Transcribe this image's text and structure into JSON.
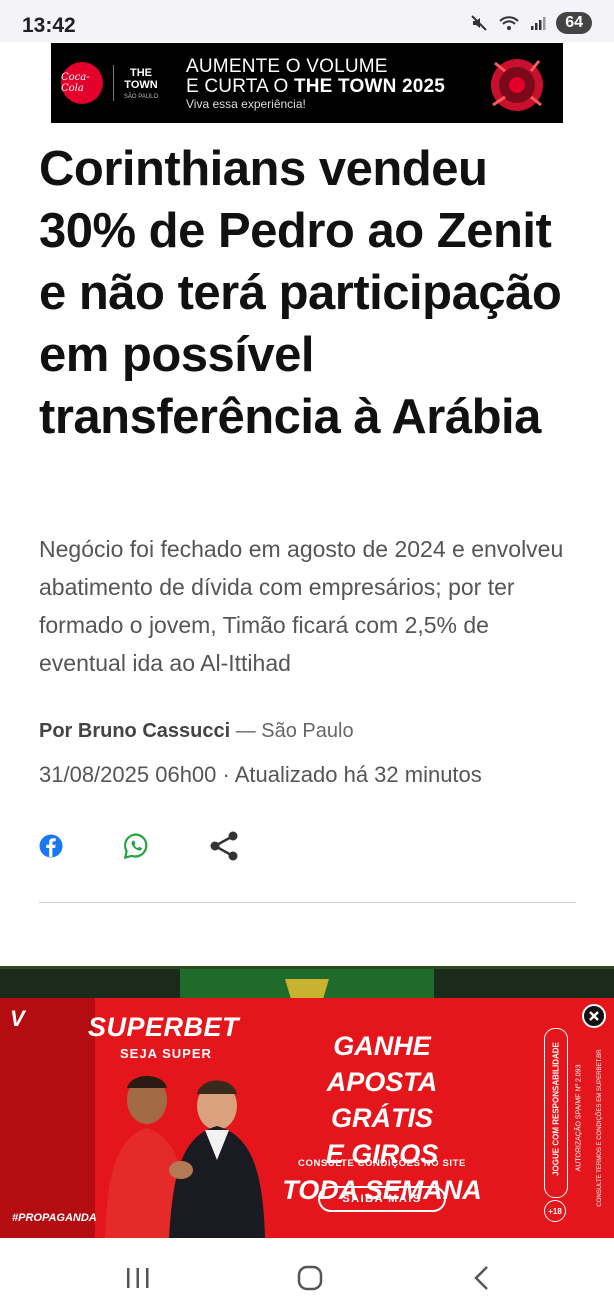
{
  "status_bar": {
    "time": "13:42",
    "battery": "64"
  },
  "top_ad": {
    "brand": "Coca-Cola",
    "event_logo_line1": "THE",
    "event_logo_line2": "TOWN",
    "event_logo_sub": "SÃO PAULO",
    "line1": "AUMENTE O VOLUME",
    "line2_prefix": "E CURTA O ",
    "line2_bold": "THE TOWN 2025",
    "line3": "Viva essa experiência!"
  },
  "article": {
    "headline": "Corinthians vendeu 30% de Pedro ao Zenit e não terá participação em possível transferência à Arábia",
    "subtitle": "Negócio foi fechado em agosto de 2024 e envolveu abatimento de dívida com empresários; por ter formado o jovem, Timão ficará com 2,5% de eventual ida ao Al-Ittihad",
    "author_prefix": "Por Bruno Cassucci",
    "location": " — São Paulo",
    "dateline": "31/08/2025 06h00 · Atualizado há 32 minutos"
  },
  "share": {
    "icons": [
      "facebook-icon",
      "whatsapp-icon",
      "share-icon"
    ]
  },
  "bottom_ad": {
    "brand": "SUPERBET",
    "tagline": "SEJA SUPER",
    "promo": [
      "GANHE",
      "APOSTA GRÁTIS",
      "E GIROS",
      "TODA SEMANA"
    ],
    "consult": "CONSULTE CONDIÇÕES NO SITE",
    "cta": "SAIBA MAIS",
    "tag": "#PROPAGANDA",
    "legal1": "JOGUE COM RESPONSABILIDADE",
    "legal2": "AUTORIZAÇÃO SPA/MF Nº 2.093",
    "legal3": "CONSULTE TERMOS E CONDIÇÕES EM SUPERBET.BR",
    "age": "+18",
    "colors": {
      "primary": "#e4161c"
    }
  }
}
